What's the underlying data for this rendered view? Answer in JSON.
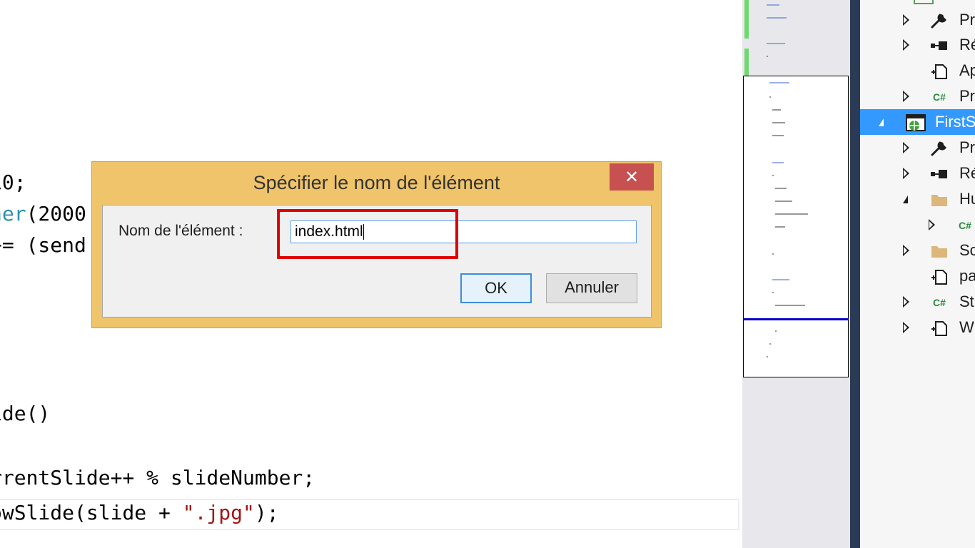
{
  "editor": {
    "lines": [
      {
        "plain": "10;"
      },
      {
        "type_name": "ner",
        "rest": "(2000"
      },
      {
        "plain": "+= (send"
      },
      {
        "plain": "ide()"
      },
      {
        "plain": "rrentSlide++ % slideNumber;"
      },
      {
        "pre": "owSlide(slide + ",
        "string": "\".jpg\"",
        "post": ");"
      }
    ]
  },
  "solution_explorer": {
    "items": [
      {
        "label": "Pr",
        "icon": "wrench-icon",
        "expander": "collapsed"
      },
      {
        "label": "Ré",
        "icon": "references-icon",
        "expander": "collapsed"
      },
      {
        "label": "Ap",
        "icon": "config-file-icon",
        "expander": "none"
      },
      {
        "label": "Pr",
        "icon": "csharp-file-icon",
        "icon_text": "C#",
        "expander": "collapsed"
      },
      {
        "label": "FirstS",
        "icon": "web-project-icon",
        "expander": "expanded",
        "selected": true
      },
      {
        "label": "Pr",
        "icon": "wrench-icon",
        "expander": "collapsed"
      },
      {
        "label": "Ré",
        "icon": "references-icon",
        "expander": "collapsed"
      },
      {
        "label": "Hu",
        "icon": "folder-icon",
        "expander": "expanded"
      },
      {
        "label": "",
        "icon": "csharp-file-icon",
        "icon_text": "C#",
        "expander": "collapsed"
      },
      {
        "label": "Sc",
        "icon": "folder-icon",
        "expander": "collapsed"
      },
      {
        "label": "pa",
        "icon": "config-file-icon",
        "expander": "none"
      },
      {
        "label": "St",
        "icon": "csharp-file-icon",
        "icon_text": "C#",
        "expander": "collapsed"
      },
      {
        "label": "W",
        "icon": "config-file-icon",
        "expander": "collapsed"
      }
    ]
  },
  "dialog": {
    "title": "Spécifier le nom de l'élément",
    "close_glyph": "✕",
    "field_label": "Nom de l'élément :",
    "field_value": "index.html",
    "ok_label": "OK",
    "cancel_label": "Annuler"
  },
  "colors": {
    "dialog_frame": "#f0c46a",
    "close_button": "#c75050",
    "highlight_box": "#e00000",
    "selection": "#3399ff",
    "type_name": "#2b91af",
    "string": "#a31515"
  }
}
